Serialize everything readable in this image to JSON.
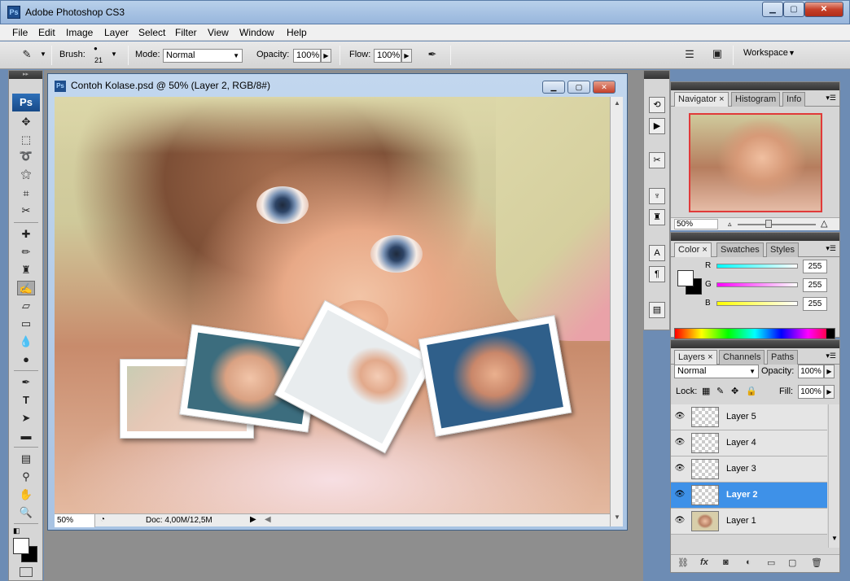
{
  "window": {
    "title": "Adobe Photoshop CS3",
    "app_icon": "Ps"
  },
  "menu": [
    "File",
    "Edit",
    "Image",
    "Layer",
    "Select",
    "Filter",
    "View",
    "Window",
    "Help"
  ],
  "options": {
    "brush_label": "Brush:",
    "brush_size": "21",
    "mode_label": "Mode:",
    "mode_value": "Normal",
    "opacity_label": "Opacity:",
    "opacity_value": "100%",
    "flow_label": "Flow:",
    "flow_value": "100%",
    "workspace_label": "Workspace"
  },
  "toolbox": {
    "logo": "Ps"
  },
  "document": {
    "title": "Contoh Kolase.psd @ 50% (Layer 2, RGB/8#)",
    "icon": "Ps",
    "zoom": "50%",
    "doc_info": "Doc: 4,00M/12,5M"
  },
  "navigator": {
    "tabs": [
      "Navigator",
      "Histogram",
      "Info"
    ],
    "zoom": "50%"
  },
  "color": {
    "tabs": [
      "Color",
      "Swatches",
      "Styles"
    ],
    "r_label": "R",
    "r_value": "255",
    "g_label": "G",
    "g_value": "255",
    "b_label": "B",
    "b_value": "255"
  },
  "layers": {
    "tabs": [
      "Layers",
      "Channels",
      "Paths"
    ],
    "blend_mode": "Normal",
    "opacity_label": "Opacity:",
    "opacity_value": "100%",
    "lock_label": "Lock:",
    "fill_label": "Fill:",
    "fill_value": "100%",
    "items": [
      {
        "name": "Layer 5",
        "selected": false
      },
      {
        "name": "Layer 4",
        "selected": false
      },
      {
        "name": "Layer 3",
        "selected": false
      },
      {
        "name": "Layer 2",
        "selected": true
      },
      {
        "name": "Layer 1",
        "selected": false
      }
    ]
  },
  "colors": {
    "selection": "#3e91e8",
    "title_bar": "#a9c4e4",
    "workspace": "#8e8e8e"
  }
}
